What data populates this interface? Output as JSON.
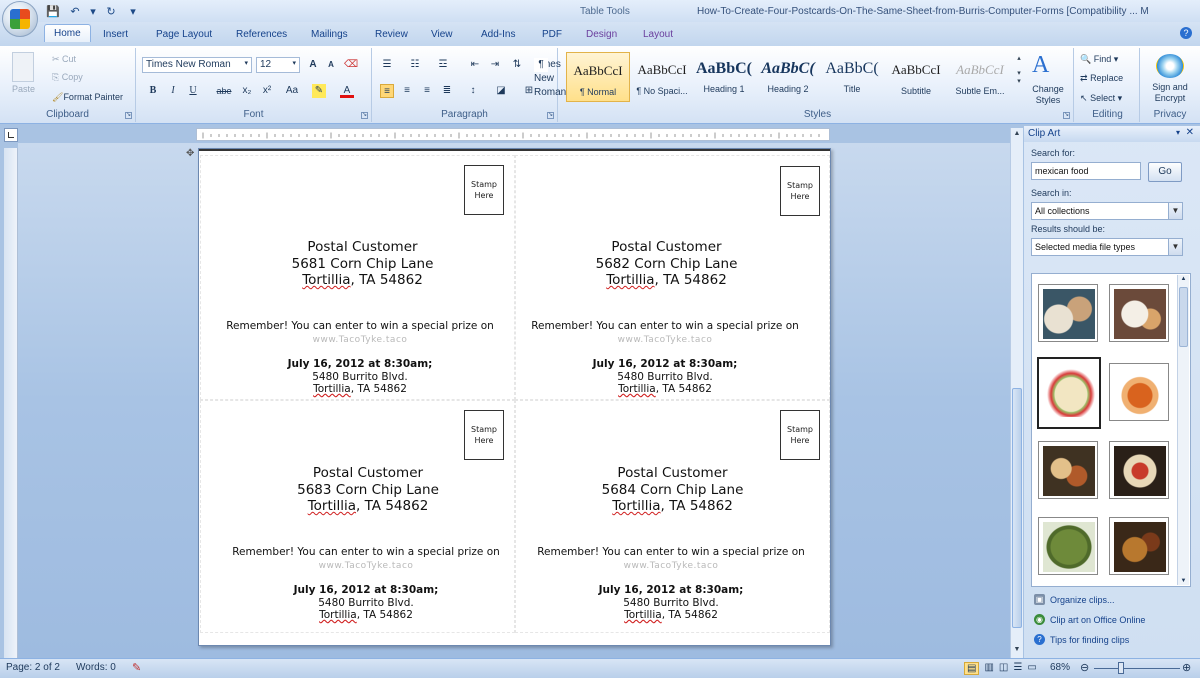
{
  "title_bar": {
    "context_tab_group": "Table Tools",
    "document_title": "How-To-Create-Four-Postcards-On-The-Same-Sheet-from-Burris-Computer-Forms [Compatibility ... M"
  },
  "tabs": [
    "Home",
    "Insert",
    "Page Layout",
    "References",
    "Mailings",
    "Review",
    "View",
    "Add-Ins",
    "PDF",
    "Design",
    "Layout"
  ],
  "ribbon": {
    "clipboard": {
      "paste": "Paste",
      "cut": "Cut",
      "copy": "Copy",
      "format_painter": "Format Painter",
      "label": "Clipboard"
    },
    "font": {
      "name": "Times New Roman",
      "size": "12",
      "label": "Font",
      "bold": "B",
      "italic": "I",
      "underline": "U",
      "strike": "abe",
      "sub": "x₂",
      "sup": "x²",
      "case": "Aa",
      "grow": "A",
      "shrink": "A",
      "color": "A"
    },
    "paragraph": {
      "label": "Paragraph",
      "pilcrow": "¶"
    },
    "styles": {
      "label": "Styles",
      "items": [
        {
          "preview": "AaBbCcI",
          "name": "¶ Normal"
        },
        {
          "preview": "AaBbCcI",
          "name": "¶ No Spaci..."
        },
        {
          "preview": "AaBbC(",
          "name": "Heading 1"
        },
        {
          "preview": "AaBbC(",
          "name": "Heading 2"
        },
        {
          "preview": "AaBbC(",
          "name": "Title"
        },
        {
          "preview": "AaBbCcI",
          "name": "Subtitle"
        },
        {
          "preview": "AaBbCcI",
          "name": "Subtle Em..."
        }
      ],
      "change_styles": "Change Styles"
    },
    "editing": {
      "find": "Find",
      "replace": "Replace",
      "select": "Select",
      "label": "Editing"
    },
    "privacy": {
      "sign": "Sign and Encrypt",
      "label": "Privacy"
    }
  },
  "postcards": [
    {
      "stamp": "Stamp Here",
      "name": "Postal Customer",
      "street": "5681 Corn Chip  Lane",
      "city_word": "Tortillia",
      "city_rest": ", TA 54862",
      "remember": "Remember! You can enter to win a special prize on",
      "url": "www.TacoTyke.taco",
      "date": "July 16, 2012 at 8:30am;",
      "addr1": "5480 Burrito Blvd.",
      "addr2_word": "Tortillia",
      "addr2_rest": ", TA 54862"
    },
    {
      "stamp": "Stamp Here",
      "name": "Postal Customer",
      "street": "5682 Corn Chip  Lane",
      "city_word": "Tortillia",
      "city_rest": ", TA 54862",
      "remember": "Remember! You can enter to win a special prize on",
      "url": "www.TacoTyke.taco",
      "date": "July 16, 2012 at 8:30am;",
      "addr1": "5480 Burrito Blvd.",
      "addr2_word": "Tortillia",
      "addr2_rest": ", TA 54862"
    },
    {
      "stamp": "Stamp Here",
      "name": "Postal Customer",
      "street": "5683 Corn Chip  Lane",
      "city_word": "Tortillia",
      "city_rest": ", TA 54862",
      "remember": "Remember! You can enter to win a special prize on",
      "url": "www.TacoTyke.taco",
      "date": "July 16, 2012 at 8:30am;",
      "addr1": "5480 Burrito Blvd.",
      "addr2_word": "Tortillia",
      "addr2_rest": ", TA 54862"
    },
    {
      "stamp": "Stamp Here",
      "name": "Postal Customer",
      "street": "5684 Corn Chip  Lane",
      "city_word": "Tortillia",
      "city_rest": ", TA 54862",
      "remember": "Remember! You can enter to win a special prize on",
      "url": "www.TacoTyke.taco",
      "date": "July 16, 2012 at 8:30am;",
      "addr1": "5480 Burrito Blvd.",
      "addr2_word": "Tortillia",
      "addr2_rest": ", TA 54862"
    }
  ],
  "clip_art": {
    "title": "Clip Art",
    "search_for_label": "Search for:",
    "search_value": "mexican food",
    "go": "Go",
    "search_in_label": "Search in:",
    "search_in_value": "All collections",
    "results_label": "Results should be:",
    "results_value": "Selected media file types",
    "links": [
      "Organize clips...",
      "Clip art on Office Online",
      "Tips for finding clips"
    ]
  },
  "status": {
    "page": "Page: 2 of 2",
    "words": "Words: 0",
    "zoom": "68%"
  }
}
